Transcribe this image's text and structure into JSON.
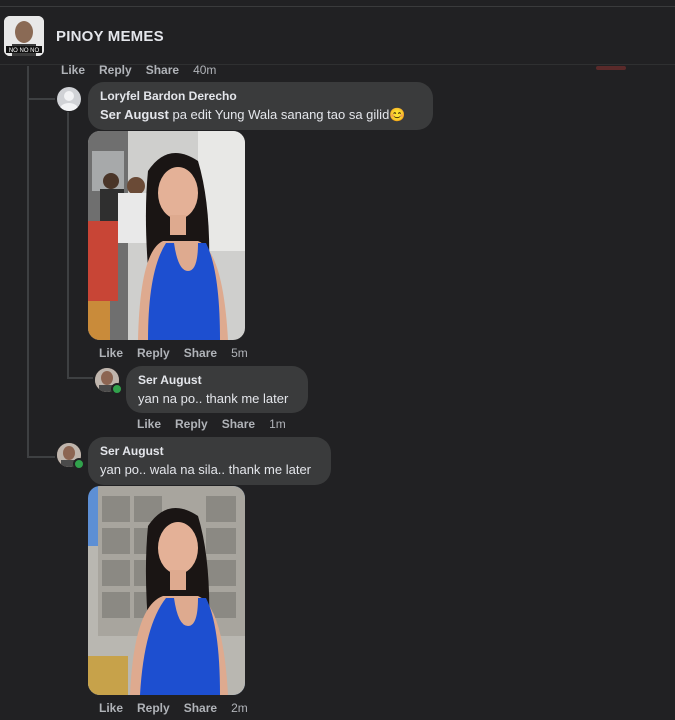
{
  "page": {
    "name": "PINOY MEMES",
    "avatar_icon": "page-avatar-icon"
  },
  "actions_common": {
    "like": "Like",
    "reply": "Reply",
    "share": "Share"
  },
  "comments": [
    {
      "time": "40m"
    },
    {
      "author": "Loryfel Bardon Derecho",
      "mention": "Ser August",
      "text": " pa edit Yung Wala sanang tao sa gilid",
      "emoji": "😊",
      "time": "5m"
    },
    {
      "author": "Ser August",
      "text": "yan na po.. thank me later",
      "time": "1m"
    },
    {
      "author": "Ser August",
      "text": "yan po.. wala na sila.. thank me later",
      "time": "2m"
    }
  ],
  "colors": {
    "background": "#212123",
    "bubble": "#3a3b3c",
    "online": "#31a24c",
    "dress": "#1d4fd0"
  }
}
